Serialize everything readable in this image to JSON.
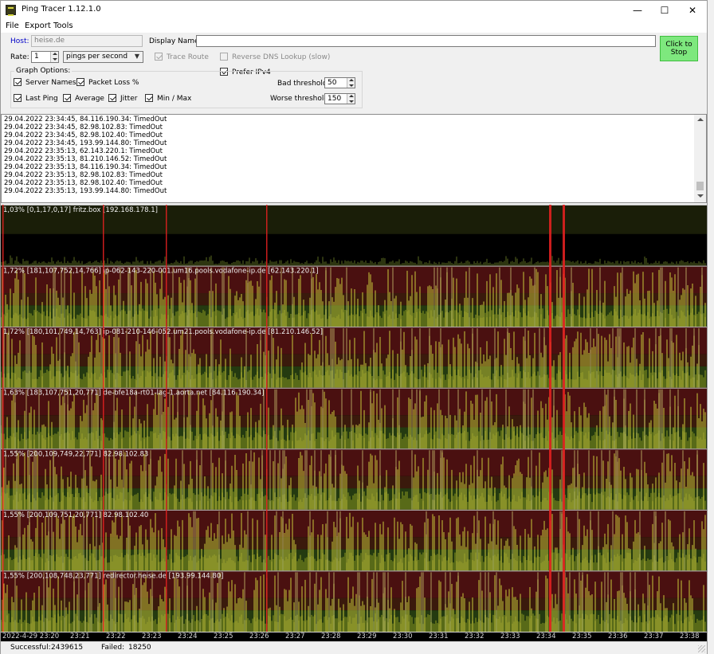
{
  "window": {
    "title": "Ping Tracer 1.12.1.0"
  },
  "menu": [
    "File",
    "Export",
    "Tools"
  ],
  "host": {
    "label": "Host:",
    "value": "heise.de"
  },
  "display_name": {
    "label": "Display Name:",
    "value": ""
  },
  "rate": {
    "label": "Rate:",
    "value": "1",
    "unit": "pings per second"
  },
  "options": {
    "trace_route": {
      "label": "Trace Route",
      "checked": true,
      "enabled": false
    },
    "reverse_dns": {
      "label": "Reverse DNS Lookup (slow)",
      "checked": false,
      "enabled": false
    },
    "prefer_ipv4": {
      "label": "Prefer IPv4",
      "checked": true
    }
  },
  "stop_button": {
    "line1": "Click to",
    "line2": "Stop"
  },
  "graph_options": {
    "title": "Graph Options:",
    "server_names": {
      "label": "Server Names",
      "checked": true
    },
    "packet_loss": {
      "label": "Packet Loss %",
      "checked": true
    },
    "last_ping": {
      "label": "Last Ping",
      "checked": true
    },
    "average": {
      "label": "Average",
      "checked": true
    },
    "jitter": {
      "label": "Jitter",
      "checked": true
    },
    "min_max": {
      "label": "Min / Max",
      "checked": true
    }
  },
  "thresholds": {
    "bad_label": "Bad threshold:",
    "bad_value": "50",
    "worse_label": "Worse threshold:",
    "worse_value": "150"
  },
  "log": [
    "29.04.2022 23:34:45, 84.116.190.34: TimedOut",
    "29.04.2022 23:34:45, 82.98.102.83: TimedOut",
    "29.04.2022 23:34:45, 82.98.102.40: TimedOut",
    "29.04.2022 23:34:45, 193.99.144.80: TimedOut",
    "29.04.2022 23:35:13, 62.143.220.1: TimedOut",
    "29.04.2022 23:35:13, 81.210.146.52: TimedOut",
    "29.04.2022 23:35:13, 84.116.190.34: TimedOut",
    "29.04.2022 23:35:13, 82.98.102.83: TimedOut",
    "29.04.2022 23:35:13, 82.98.102.40: TimedOut",
    "29.04.2022 23:35:13, 193.99.144.80: TimedOut"
  ],
  "graphs": [
    {
      "label": "1,03% [0,1,17,0,17] fritz.box [192.168.178.1]"
    },
    {
      "label": "1,72% [181,107,752,14,766] ip-062-143-220-001.um16.pools.vodafone-ip.de [62.143.220.1]"
    },
    {
      "label": "1,72% [180,101,749,14,763] ip-081-210-146-052.um21.pools.vodafone-ip.de [81.210.146.52]"
    },
    {
      "label": "1,63% [183,107,751,20,771] de-bfe18a-rt01-lag-1.aorta.net [84.116.190.34]"
    },
    {
      "label": "1,55% [200,109,749,22,771] 82.98.102.83"
    },
    {
      "label": "1,55% [200,109,751,20,771] 82.98.102.40"
    },
    {
      "label": "1,55% [200,108,748,23,771] redirector.heise.de [193.99.144.80]"
    }
  ],
  "timeline": [
    "2022-4-29 23:20",
    "23:21",
    "23:22",
    "23:23",
    "23:24",
    "23:25",
    "23:26",
    "23:27",
    "23:28",
    "23:29",
    "23:30",
    "23:31",
    "23:32",
    "23:33",
    "23:34",
    "23:35",
    "23:36",
    "23:37",
    "23:38"
  ],
  "status": {
    "successful_label": "Successful:",
    "successful_value": "2439615",
    "failed_label": "Failed:",
    "failed_value": "18250"
  },
  "colors": {
    "ping_good": "#c8c83a",
    "ping_bad": "#e0e080",
    "band_bad": "#4a1010",
    "band_ok": "#243a10",
    "timeout": "#e02020",
    "accent": "#0000c8"
  }
}
